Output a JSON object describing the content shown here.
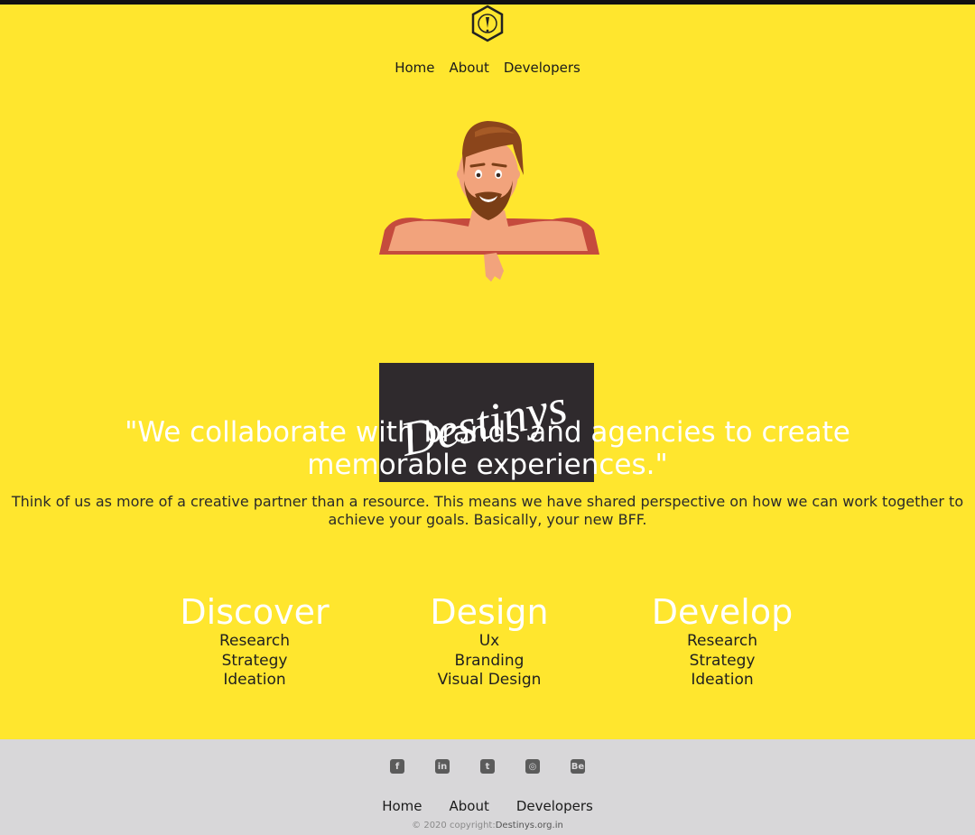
{
  "nav": {
    "items": [
      "Home",
      "About",
      "Developers"
    ]
  },
  "hero": {
    "board_text": "Destinys"
  },
  "quote": "\"We collaborate with brands and agencies to create memorable experiences.\"",
  "tagline": "Think of us as more of a creative partner than a resource. This means we have shared perspective on how we can work together to achieve your goals. Basically, your new BFF.",
  "services": [
    {
      "title": "Discover",
      "items": [
        "Research",
        "Strategy",
        "Ideation"
      ]
    },
    {
      "title": "Design",
      "items": [
        "Ux",
        "Branding",
        "Visual Design"
      ]
    },
    {
      "title": "Develop",
      "items": [
        "Research",
        "Strategy",
        "Ideation"
      ]
    }
  ],
  "footer": {
    "social": [
      "facebook-icon",
      "linkedin-icon",
      "twitter-icon",
      "github-icon",
      "behance-icon"
    ],
    "social_glyphs": [
      "f",
      "in",
      "t",
      "◎",
      "Be"
    ],
    "nav": [
      "Home",
      "About",
      "Developers"
    ],
    "copyright_prefix": "© 2020 copyright:",
    "copyright_site": "Destinys.org.in"
  },
  "colors": {
    "background": "#ffe62e",
    "footer": "#d8d7d9",
    "board": "#2f2a2d"
  }
}
